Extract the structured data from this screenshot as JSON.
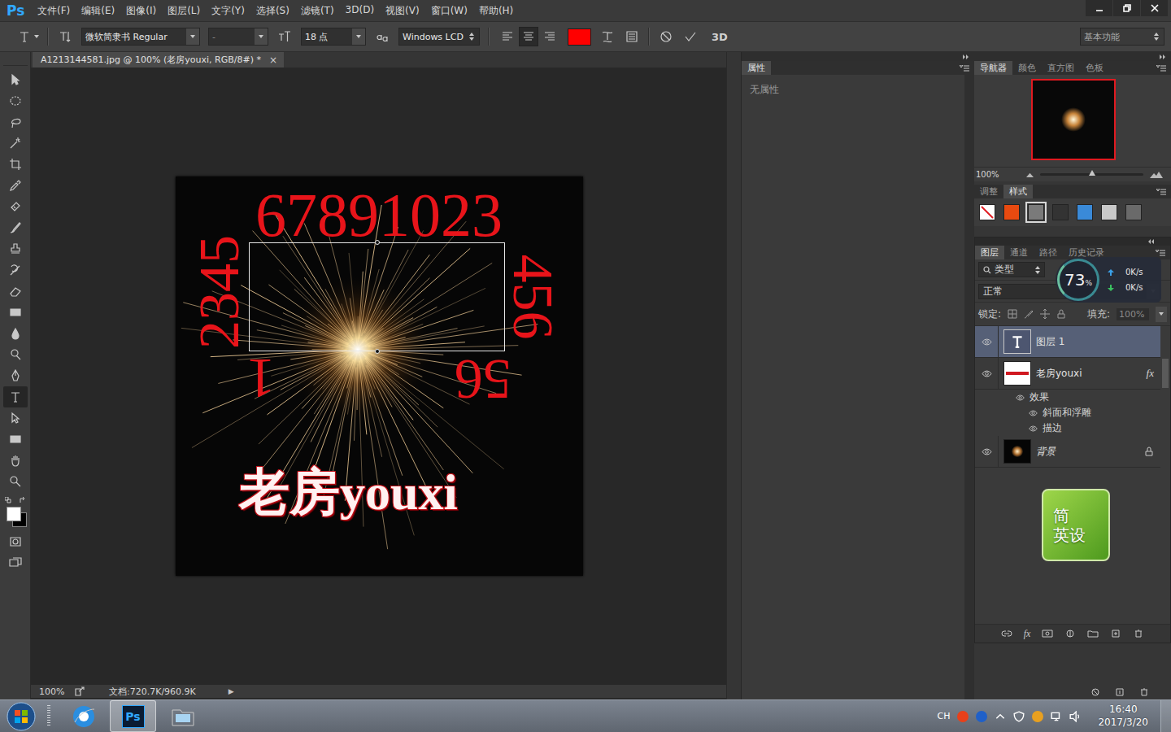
{
  "app": {
    "logo": "Ps",
    "menus": [
      "文件(F)",
      "编辑(E)",
      "图像(I)",
      "图层(L)",
      "文字(Y)",
      "选择(S)",
      "滤镜(T)",
      "3D(D)",
      "视图(V)",
      "窗口(W)",
      "帮助(H)"
    ]
  },
  "options": {
    "font_family": "微软简隶书 Regular",
    "font_style": "-",
    "font_size": "18 点",
    "antialias": "Windows LCD",
    "align": [
      {
        "selected": false
      },
      {
        "selected": true
      },
      {
        "selected": false
      }
    ],
    "color": "#ff0000",
    "threed": "3D",
    "workspace": "基本功能"
  },
  "tools": [
    {
      "selected": false
    },
    {
      "selected": false
    },
    {
      "selected": false
    },
    {
      "selected": false
    },
    {
      "selected": false
    },
    {
      "selected": false
    },
    {
      "selected": false
    },
    {
      "selected": false
    },
    {
      "selected": false
    },
    {
      "selected": false
    },
    {
      "selected": false
    },
    {
      "selected": false
    },
    {
      "selected": false
    },
    {
      "selected": false
    },
    {
      "selected": false
    },
    {
      "selected": true
    },
    {
      "selected": false
    },
    {
      "selected": false
    },
    {
      "selected": false
    },
    {
      "selected": false
    }
  ],
  "colors": {
    "foreground": "#ffffff",
    "background": "#000000"
  },
  "document": {
    "tab": "A1213144581.jpg @ 100% (老房youxi, RGB/8#) *",
    "close": "×",
    "texts": {
      "top": "67891023",
      "left": "2345",
      "right": "456",
      "bottom_left": "1",
      "bottom_right": "56",
      "title": "老房youxi"
    }
  },
  "status_bar": {
    "zoom": "100%",
    "doc_size": "文档:720.7K/960.9K",
    "menu_arrow": "▶"
  },
  "properties": {
    "tab": "属性",
    "empty": "无属性"
  },
  "navigator": {
    "tabs": [
      {
        "label": "导航器",
        "selected": true
      },
      {
        "label": "颜色",
        "selected": false
      },
      {
        "label": "直方图",
        "selected": false
      },
      {
        "label": "色板",
        "selected": false
      }
    ],
    "zoom": "100%",
    "level": 0.5
  },
  "styles": {
    "tabs": [
      {
        "label": "调整",
        "selected": false
      },
      {
        "label": "样式",
        "selected": true
      }
    ],
    "swatches": [
      {
        "kind": "none",
        "color": "#ffffff",
        "selected": false
      },
      {
        "kind": "fill",
        "color": "#e84a10",
        "selected": false
      },
      {
        "kind": "fill",
        "color": "#7a7a7a",
        "selected": true
      },
      {
        "kind": "fill",
        "color": "#333333",
        "selected": false
      },
      {
        "kind": "fill",
        "color": "#3a8ad8",
        "selected": false
      },
      {
        "kind": "fill",
        "color": "#c8c8c8",
        "selected": false
      },
      {
        "kind": "fill",
        "color": "#6a6a6a",
        "selected": false
      }
    ]
  },
  "layers": {
    "tabs": [
      {
        "label": "图层",
        "selected": true
      },
      {
        "label": "通道",
        "selected": false
      },
      {
        "label": "路径",
        "selected": false
      },
      {
        "label": "历史记录",
        "selected": false
      }
    ],
    "filter": "类型",
    "blend": "正常",
    "lock_label": "锁定:",
    "fill_label": "填充:",
    "fill": "100%",
    "footer_fx": "fx",
    "items": [
      {
        "kind": "text",
        "name": "图层 1",
        "selected": true,
        "visible": true,
        "fx": "",
        "locked": false,
        "effects_label": "",
        "effects": []
      },
      {
        "kind": "image",
        "name": "老房youxi",
        "selected": false,
        "visible": true,
        "fx": "fx",
        "locked": false,
        "effects_label": "效果",
        "effects": [
          {
            "name": "斜面和浮雕",
            "visible": true
          },
          {
            "name": "描边",
            "visible": true
          }
        ]
      },
      {
        "kind": "photo",
        "name": "背景",
        "selected": false,
        "visible": true,
        "fx": "",
        "locked": true,
        "effects_label": "",
        "effects": []
      }
    ]
  },
  "net_meter": {
    "value": "73",
    "unit": "%",
    "up": "0K/s",
    "down": "0K/s"
  },
  "ime": {
    "mode": "简",
    "label": "英设"
  },
  "taskbar": {
    "apps": [
      {
        "kind": "ie",
        "label": "",
        "selected": false
      },
      {
        "kind": "ps",
        "label": "Ps",
        "selected": true
      },
      {
        "kind": "folder",
        "label": "",
        "selected": false
      }
    ],
    "lang": "CH",
    "time": "16:40",
    "date": "2017/3/20"
  }
}
